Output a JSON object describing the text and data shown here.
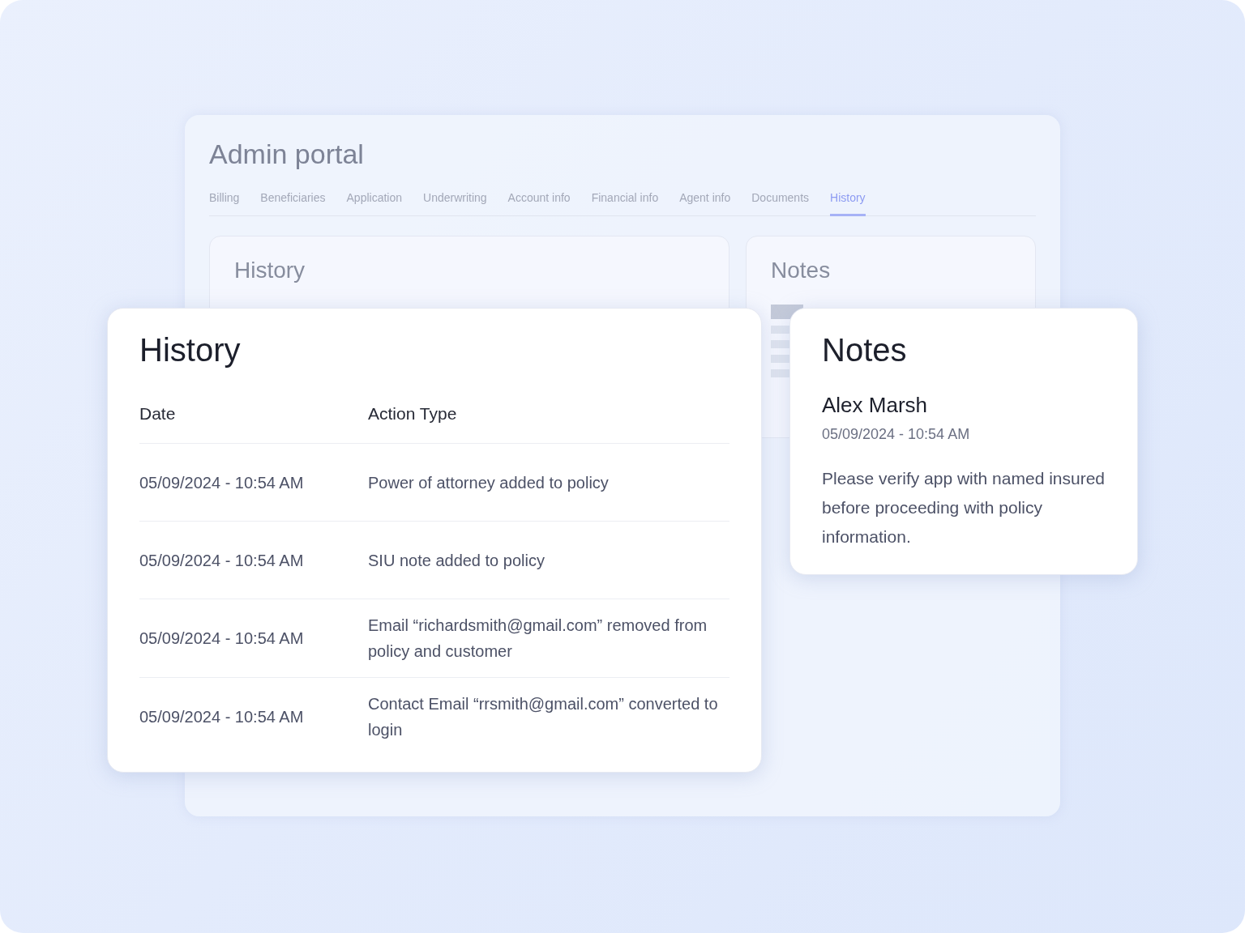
{
  "portal": {
    "title": "Admin portal",
    "tabs": [
      {
        "label": "Billing",
        "selected": false
      },
      {
        "label": "Beneficiaries",
        "selected": false
      },
      {
        "label": "Application",
        "selected": false
      },
      {
        "label": "Underwriting",
        "selected": false
      },
      {
        "label": "Account info",
        "selected": false
      },
      {
        "label": "Financial info",
        "selected": false
      },
      {
        "label": "Agent info",
        "selected": false
      },
      {
        "label": "Documents",
        "selected": false
      },
      {
        "label": "History",
        "selected": true
      }
    ],
    "history_panel": {
      "title": "History"
    },
    "notes_panel": {
      "title": "Notes"
    }
  },
  "history_card": {
    "title": "History",
    "columns": [
      "Date",
      "Action Type"
    ],
    "rows": [
      {
        "date": "05/09/2024 - 10:54 AM",
        "action": "Power of attorney added to policy"
      },
      {
        "date": "05/09/2024 - 10:54 AM",
        "action": "SIU note added to policy"
      },
      {
        "date": "05/09/2024 - 10:54 AM",
        "action": "Email “richardsmith@gmail.com” removed from policy and customer"
      },
      {
        "date": "05/09/2024 - 10:54 AM",
        "action": "Contact Email “rrsmith@gmail.com” converted to login"
      }
    ]
  },
  "notes_card": {
    "title": "Notes",
    "author": "Alex Marsh",
    "timestamp": "05/09/2024 - 10:54 AM",
    "body": "Please verify app with named insured before proceeding with policy information."
  }
}
